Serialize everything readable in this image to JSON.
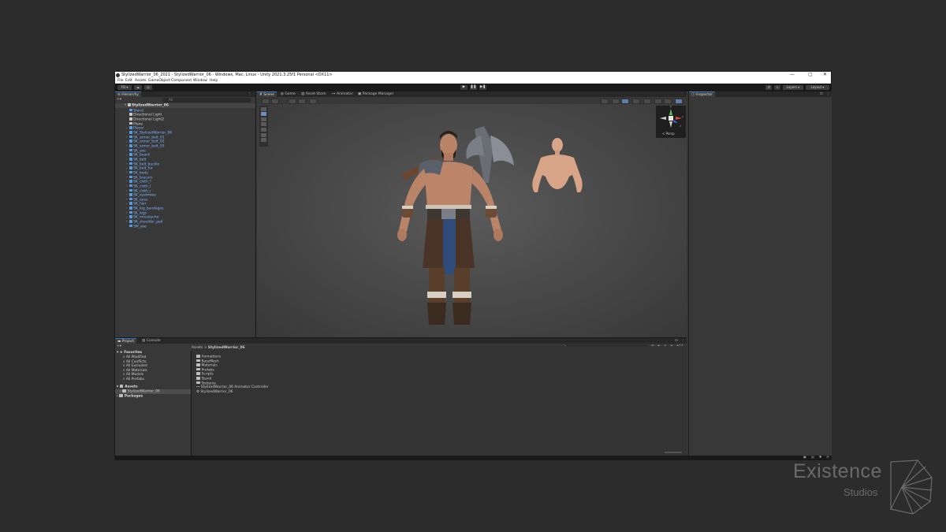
{
  "window": {
    "title": "StylizedWarrior_06_2021 - StylizedWarrior_06 - Windows, Mac, Linux - Unity 2021.3.25f1 Personal <DX11>",
    "controls": [
      "—",
      "▢",
      "✕"
    ]
  },
  "menu": [
    "File",
    "Edit",
    "Assets",
    "GameObject",
    "Component",
    "Window",
    "Help"
  ],
  "toolbar": {
    "account": "FD ▾",
    "layers": "Layers ▾",
    "layout": "Layout ▾",
    "play": "▶",
    "pause": "❚❚",
    "step": "▶❚"
  },
  "hierarchy": {
    "tab": "Hierarchy",
    "search_placeholder": "All",
    "root": "StylizedWarrior_06",
    "items": [
      {
        "label": "Stand",
        "type": "prefab",
        "expand": false
      },
      {
        "label": "Directional Light",
        "type": "plain",
        "expand": false
      },
      {
        "label": "Directional Light2",
        "type": "plain",
        "expand": false
      },
      {
        "label": "Plane",
        "type": "plain",
        "expand": false
      },
      {
        "label": "Player",
        "type": "prefab",
        "expand": true
      },
      {
        "label": "SK_StylizedWarrior_06",
        "type": "prefab",
        "expand": true
      },
      {
        "label": "SK_armor_belt_01",
        "type": "prefab",
        "expand": true
      },
      {
        "label": "SK_armor_belt_02",
        "type": "prefab",
        "expand": true
      },
      {
        "label": "SK_armor_belt_03",
        "type": "prefab",
        "expand": true
      },
      {
        "label": "SK_axe",
        "type": "prefab",
        "expand": true
      },
      {
        "label": "SK_beard",
        "type": "prefab",
        "expand": true
      },
      {
        "label": "SK_belt",
        "type": "prefab",
        "expand": true
      },
      {
        "label": "SK_belt_buckle",
        "type": "prefab",
        "expand": true
      },
      {
        "label": "SK_belt_fur",
        "type": "prefab",
        "expand": true
      },
      {
        "label": "SK_body",
        "type": "prefab",
        "expand": true
      },
      {
        "label": "SK_bracers",
        "type": "prefab",
        "expand": true
      },
      {
        "label": "SK_cloth_f",
        "type": "prefab",
        "expand": true
      },
      {
        "label": "SK_cloth_l",
        "type": "prefab",
        "expand": true
      },
      {
        "label": "SK_cloth_r",
        "type": "prefab",
        "expand": true
      },
      {
        "label": "SK_eyebrows",
        "type": "prefab",
        "expand": true
      },
      {
        "label": "SK_eyes",
        "type": "prefab",
        "expand": true
      },
      {
        "label": "SK_hair",
        "type": "prefab",
        "expand": true
      },
      {
        "label": "SK_leg_bandages",
        "type": "prefab",
        "expand": true
      },
      {
        "label": "SK_legs",
        "type": "prefab",
        "expand": true
      },
      {
        "label": "SK_moustache",
        "type": "prefab",
        "expand": true
      },
      {
        "label": "SK_shoulder_pad",
        "type": "prefab",
        "expand": true
      },
      {
        "label": "SM_axe",
        "type": "prefab",
        "expand": false
      }
    ]
  },
  "scene_tabs": [
    "Scene",
    "Game",
    "Asset Store",
    "Animator",
    "Package Manager"
  ],
  "scene": {
    "persp_label": "< Persp",
    "gizmo_axes": {
      "y": "y",
      "x": "x",
      "z": "z"
    }
  },
  "inspector": {
    "tab": "Inspector"
  },
  "project": {
    "tabs": [
      "Project",
      "Console"
    ],
    "favorites_label": "Favorites",
    "favorites": [
      "All Modified",
      "All Conflicts",
      "All Excluded",
      "All Materials",
      "All Models",
      "All Prefabs"
    ],
    "assets_label": "Assets",
    "assets_child": "StylizedWarrior_06",
    "packages_label": "Packages",
    "breadcrumb": [
      "Assets",
      "StylizedWarrior_06"
    ],
    "breadcrumb_sep": ">",
    "count": "14",
    "contents": [
      {
        "label": "Animations",
        "kind": "folder"
      },
      {
        "label": "BaseMesh",
        "kind": "folder"
      },
      {
        "label": "Materials",
        "kind": "folder"
      },
      {
        "label": "Prefabs",
        "kind": "folder"
      },
      {
        "label": "Scripts",
        "kind": "folder"
      },
      {
        "label": "Stand",
        "kind": "folder"
      },
      {
        "label": "Textures",
        "kind": "folder"
      },
      {
        "label": "StylizedWarrior_06 Animator Controller",
        "kind": "controller"
      },
      {
        "label": "StylizedWarrior_06",
        "kind": "scene"
      }
    ]
  },
  "watermark": {
    "line1": "Existence",
    "line2": "Studios"
  },
  "colors": {
    "accent": "#3a79bb",
    "prefab_text": "#7fb6ff",
    "background": "#2c2c2c"
  }
}
